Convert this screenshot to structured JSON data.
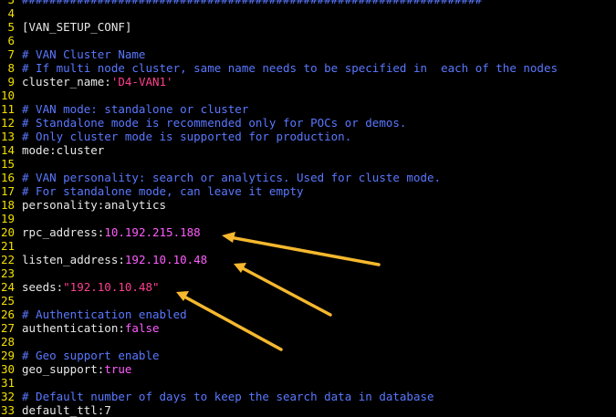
{
  "lines": [
    {
      "n": "3",
      "segs": [
        {
          "t": "###################################################################",
          "c": "comment"
        }
      ]
    },
    {
      "n": "4",
      "segs": []
    },
    {
      "n": "5",
      "segs": [
        {
          "t": "[VAN_SETUP_CONF]",
          "c": "plain"
        }
      ]
    },
    {
      "n": "6",
      "segs": []
    },
    {
      "n": "7",
      "segs": [
        {
          "t": "# VAN Cluster Name",
          "c": "comment"
        }
      ]
    },
    {
      "n": "8",
      "segs": [
        {
          "t": "# If multi node cluster, same name needs to be specified in  each of the nodes",
          "c": "comment"
        }
      ]
    },
    {
      "n": "9",
      "segs": [
        {
          "t": "cluster_name:",
          "c": "plain"
        },
        {
          "t": "'D4-VAN1'",
          "c": "string"
        }
      ]
    },
    {
      "n": "10",
      "segs": []
    },
    {
      "n": "11",
      "segs": [
        {
          "t": "# VAN mode: standalone or cluster",
          "c": "comment"
        }
      ]
    },
    {
      "n": "12",
      "segs": [
        {
          "t": "# Standalone mode is recommended only for POCs or demos.",
          "c": "comment"
        }
      ]
    },
    {
      "n": "13",
      "segs": [
        {
          "t": "# Only cluster mode is supported for production.",
          "c": "comment"
        }
      ]
    },
    {
      "n": "14",
      "segs": [
        {
          "t": "mode:cluster",
          "c": "plain"
        }
      ]
    },
    {
      "n": "15",
      "segs": []
    },
    {
      "n": "16",
      "segs": [
        {
          "t": "# VAN personality: search or analytics. Used for cluste mode.",
          "c": "comment"
        }
      ]
    },
    {
      "n": "17",
      "segs": [
        {
          "t": "# For standalone mode, can leave it empty",
          "c": "comment"
        }
      ]
    },
    {
      "n": "18",
      "segs": [
        {
          "t": "personality:analytics",
          "c": "plain"
        }
      ]
    },
    {
      "n": "19",
      "segs": []
    },
    {
      "n": "20",
      "segs": [
        {
          "t": "rpc_address:",
          "c": "plain"
        },
        {
          "t": "10.192.215.188",
          "c": "number"
        }
      ]
    },
    {
      "n": "21",
      "segs": []
    },
    {
      "n": "22",
      "segs": [
        {
          "t": "listen_address:",
          "c": "plain"
        },
        {
          "t": "192.10.10.48",
          "c": "number"
        }
      ]
    },
    {
      "n": "23",
      "segs": []
    },
    {
      "n": "24",
      "segs": [
        {
          "t": "seeds:",
          "c": "plain"
        },
        {
          "t": "\"192.10.10.48\"",
          "c": "string"
        }
      ]
    },
    {
      "n": "25",
      "segs": []
    },
    {
      "n": "26",
      "segs": [
        {
          "t": "# Authentication enabled",
          "c": "comment"
        }
      ]
    },
    {
      "n": "27",
      "segs": [
        {
          "t": "authentication:",
          "c": "plain"
        },
        {
          "t": "false",
          "c": "bool"
        }
      ]
    },
    {
      "n": "28",
      "segs": []
    },
    {
      "n": "29",
      "segs": [
        {
          "t": "# Geo support enable",
          "c": "comment"
        }
      ]
    },
    {
      "n": "30",
      "segs": [
        {
          "t": "geo_support:",
          "c": "plain"
        },
        {
          "t": "true",
          "c": "bool"
        }
      ]
    },
    {
      "n": "31",
      "segs": []
    },
    {
      "n": "32",
      "segs": [
        {
          "t": "# Default number of days to keep the search data in database",
          "c": "comment"
        }
      ]
    },
    {
      "n": "33",
      "segs": [
        {
          "t": "default_ttl:7",
          "c": "plain"
        }
      ]
    }
  ],
  "colors": {
    "background": "#000000",
    "line_number": "#f0e000",
    "text": "#e8e8e8",
    "comment": "#5a78ff",
    "string": "#ff3f8f",
    "number": "#ff5cff",
    "arrow": "#f5b82e"
  }
}
